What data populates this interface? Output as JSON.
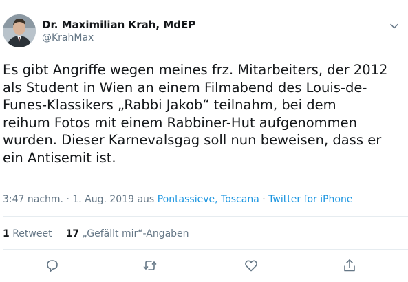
{
  "author": {
    "name": "Dr. Maximilian Krah, MdEP",
    "handle": "@KrahMax"
  },
  "tweet": {
    "text": "Es gibt Angriffe wegen meines frz. Mitarbeiters, der 2012\nals Student in Wien an einem Filmabend des Louis-de-\nFunes-Klassikers „Rabbi Jakob“ teilnahm, bei dem\nreihum Fotos mit einem Rabbiner-Hut aufgenommen\nwurden. Dieser Karnevalsgag soll nun beweisen, dass er\nein Antisemit ist."
  },
  "meta": {
    "time_date": "3:47 nachm. · 1. Aug. 2019 aus",
    "location": "Pontassieve, Toscana",
    "separator": "·",
    "client": "Twitter for iPhone"
  },
  "stats": {
    "retweets_count": "1",
    "retweets_label": "Retweet",
    "likes_count": "17",
    "likes_label": "„Gefällt mir“-Angaben"
  },
  "icons": {
    "reply": "reply-icon",
    "retweet": "retweet-icon",
    "like": "like-icon",
    "share": "share-icon",
    "menu": "chevron-down-icon"
  },
  "colors": {
    "text": "#14171a",
    "secondary": "#657786",
    "link": "#1b95e0",
    "divider": "#e6ecf0"
  }
}
